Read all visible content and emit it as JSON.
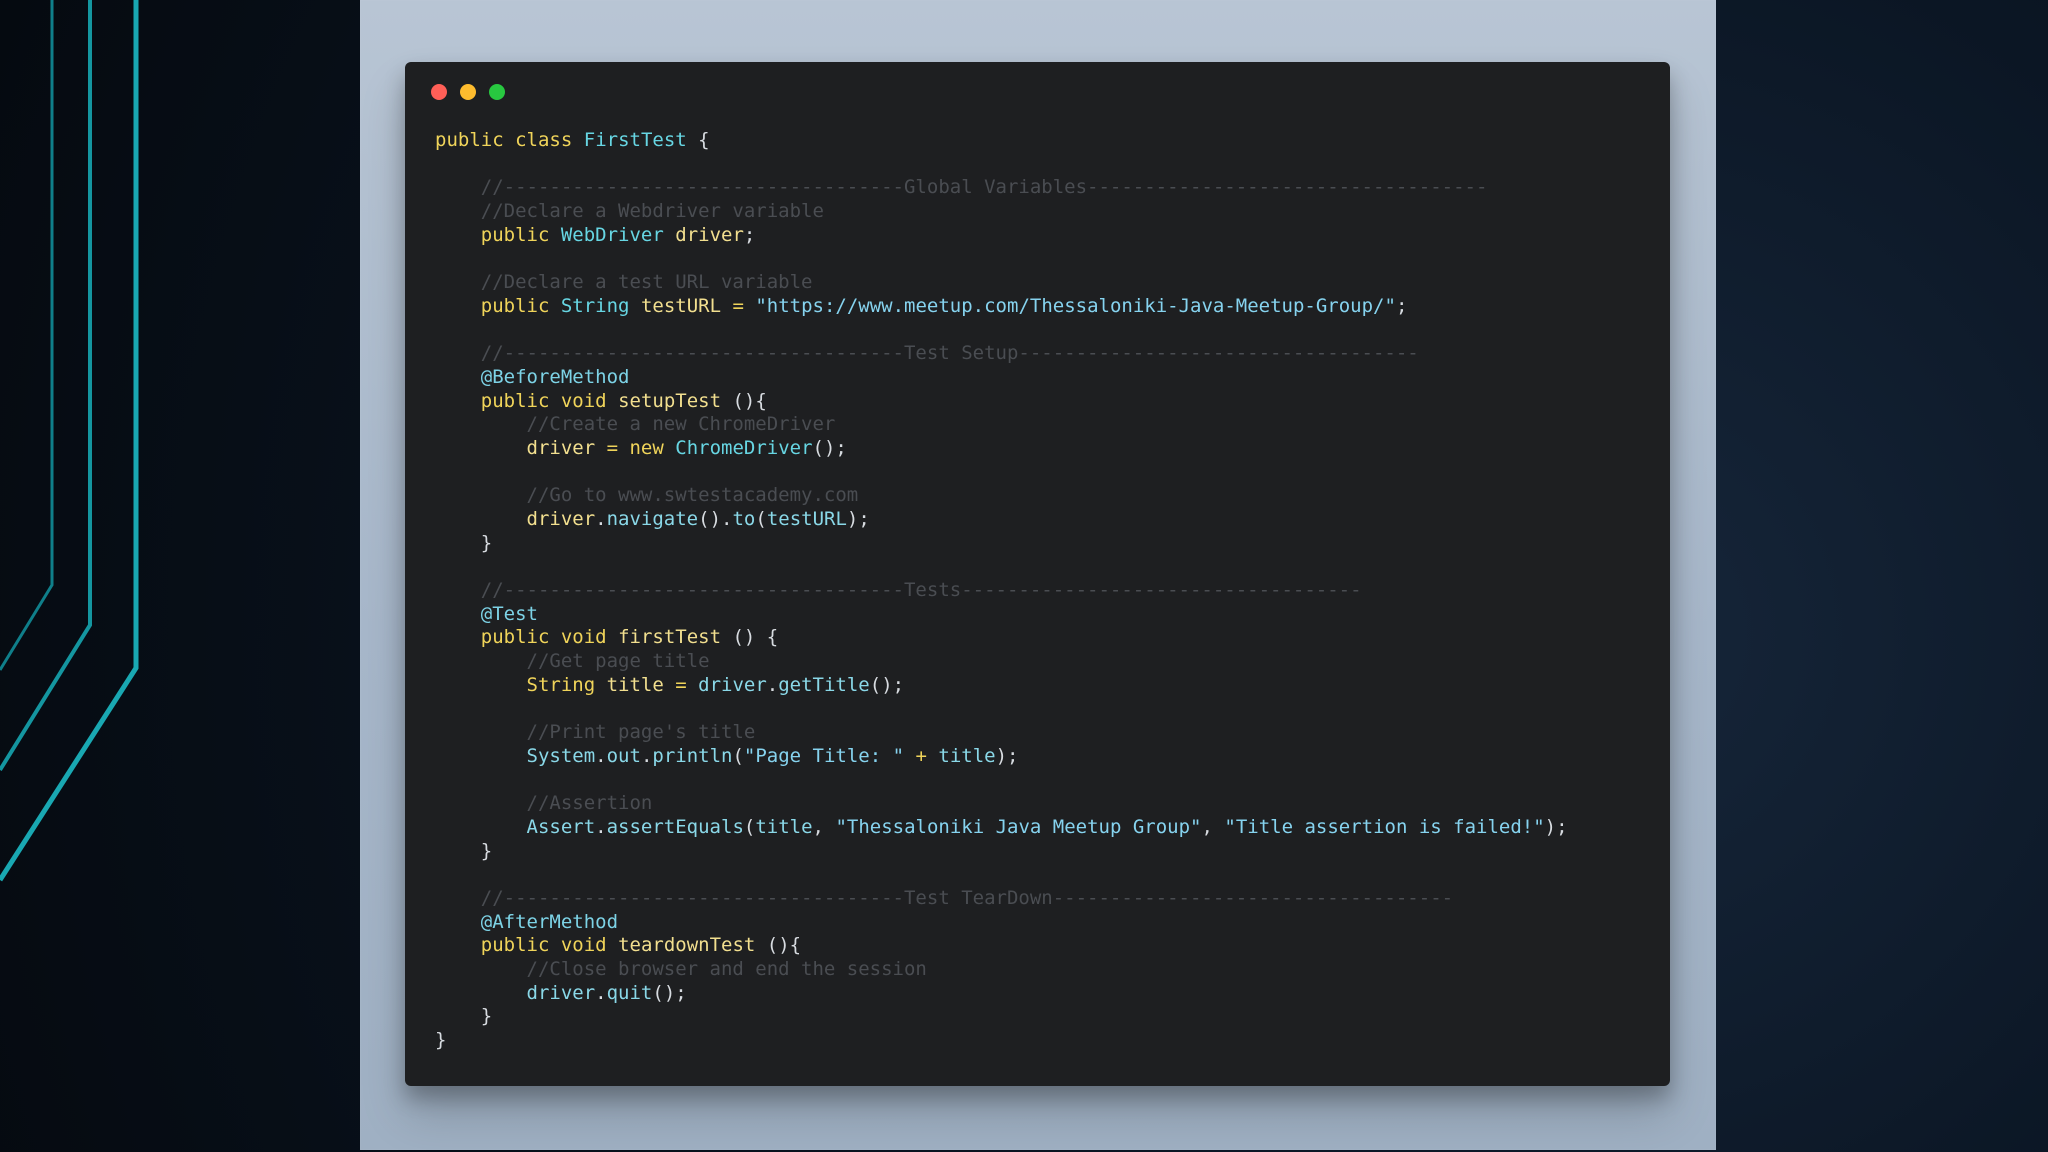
{
  "palette": {
    "background_dark": "#050a10",
    "accent_teal": "#159da7",
    "slide_background": "#aebdd0",
    "code_background": "#1e1f21",
    "window_red": "#ff5f57",
    "window_yellow": "#febc2e",
    "window_green": "#28c840"
  },
  "window_controls": [
    "close-dot",
    "minimize-dot",
    "maximize-dot"
  ],
  "code": {
    "line_1": {
      "public": "public",
      "class": "class",
      "name": "FirstTest",
      "brace": " {"
    },
    "line_2": {
      "text": ""
    },
    "line_3": {
      "comment": "    //-----------------------------------Global Variables-----------------------------------"
    },
    "line_4": {
      "comment": "    //Declare a Webdriver variable"
    },
    "line_5": {
      "public": "    public",
      "type": "WebDriver",
      "name": "driver",
      "end": ";"
    },
    "line_6": {
      "text": ""
    },
    "line_7": {
      "comment": "    //Declare a test URL variable"
    },
    "line_8": {
      "public": "    public",
      "type": "String",
      "name": "testURL",
      "equals": " = ",
      "string": "\"https://www.meetup.com/Thessaloniki-Java-Meetup-Group/\"",
      "end": ";"
    },
    "line_9": {
      "text": ""
    },
    "line_10": {
      "comment": "    //-----------------------------------Test Setup-----------------------------------"
    },
    "line_11": {
      "annotation": "    @BeforeMethod"
    },
    "line_12": {
      "public": "    public",
      "void": "void",
      "name": "setupTest",
      "tail": " (){"
    },
    "line_13": {
      "comment": "        //Create a new ChromeDriver"
    },
    "line_14": {
      "lead": "        driver",
      "equals": " = ",
      "new": "new",
      "type": "ChromeDriver",
      "tail": "();"
    },
    "line_15": {
      "text": ""
    },
    "line_16": {
      "comment": "        //Go to www.swtestacademy.com"
    },
    "line_17": {
      "lead": "        driver",
      "dot1": ".",
      "method1": "navigate",
      "mid": "()",
      "dot2": ".",
      "method2": "to",
      "tail_start": "(",
      "arg": "testURL",
      "tail_end": ");"
    },
    "line_18": {
      "text": "    }"
    },
    "line_19": {
      "text": ""
    },
    "line_20": {
      "comment": "    //-----------------------------------Tests-----------------------------------"
    },
    "line_21": {
      "annotation": "    @Test"
    },
    "line_22": {
      "public": "    public",
      "void": "void",
      "name": "firstTest",
      "tail": " () {"
    },
    "line_23": {
      "comment": "        //Get page title"
    },
    "line_24": {
      "type": "        String",
      "name": "title",
      "equals": " = ",
      "object": "driver",
      "dot": ".",
      "method": "getTitle",
      "tail": "();"
    },
    "line_25": {
      "text": ""
    },
    "line_26": {
      "comment": "        //Print page's title"
    },
    "line_27": {
      "object": "        System",
      "dot1": ".",
      "field": "out",
      "dot2": ".",
      "method": "println",
      "open": "(",
      "string": "\"Page Title: \"",
      "plus": " + ",
      "arg": "title",
      "tail": ");"
    },
    "line_28": {
      "text": ""
    },
    "line_29": {
      "comment": "        //Assertion"
    },
    "line_30": {
      "object": "        Assert",
      "dot": ".",
      "method": "assertEquals",
      "open": "(",
      "arg": "title",
      "comma1": ", ",
      "string1": "\"Thessaloniki Java Meetup Group\"",
      "comma2": ", ",
      "string2": "\"Title assertion is failed!\"",
      "tail": ");"
    },
    "line_31": {
      "text": "    }"
    },
    "line_32": {
      "text": ""
    },
    "line_33": {
      "comment": "    //-----------------------------------Test TearDown-----------------------------------"
    },
    "line_34": {
      "annotation": "    @AfterMethod"
    },
    "line_35": {
      "public": "    public",
      "void": "void",
      "name": "teardownTest",
      "tail": " (){"
    },
    "line_36": {
      "comment": "        //Close browser and end the session"
    },
    "line_37": {
      "lead": "        driver",
      "dot": ".",
      "method": "quit",
      "tail": "();"
    },
    "line_38": {
      "text": "    }"
    },
    "line_39": {
      "text": "}"
    }
  }
}
